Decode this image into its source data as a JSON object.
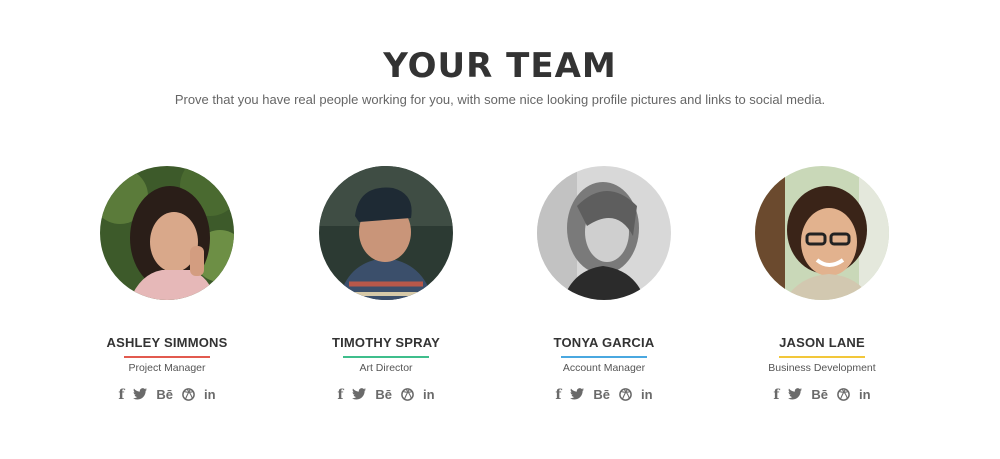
{
  "section": {
    "title": "YOUR TEAM",
    "subtitle": "Prove that you have real people working for you, with some nice looking profile pictures and links to social media."
  },
  "members": [
    {
      "name": "ASHLEY SIMMONS",
      "role": "Project Manager",
      "accent": "#e25a4f"
    },
    {
      "name": "TIMOTHY SPRAY",
      "role": "Art Director",
      "accent": "#3fbe8c"
    },
    {
      "name": "TONYA GARCIA",
      "role": "Account Manager",
      "accent": "#4aa8e0"
    },
    {
      "name": "JASON LANE",
      "role": "Business Development",
      "accent": "#f2c73a"
    }
  ],
  "social_icons": {
    "facebook": "f",
    "twitter": "twitter-bird",
    "behance": "Bē",
    "dribbble": "dribbble-ball",
    "linkedin": "in"
  }
}
